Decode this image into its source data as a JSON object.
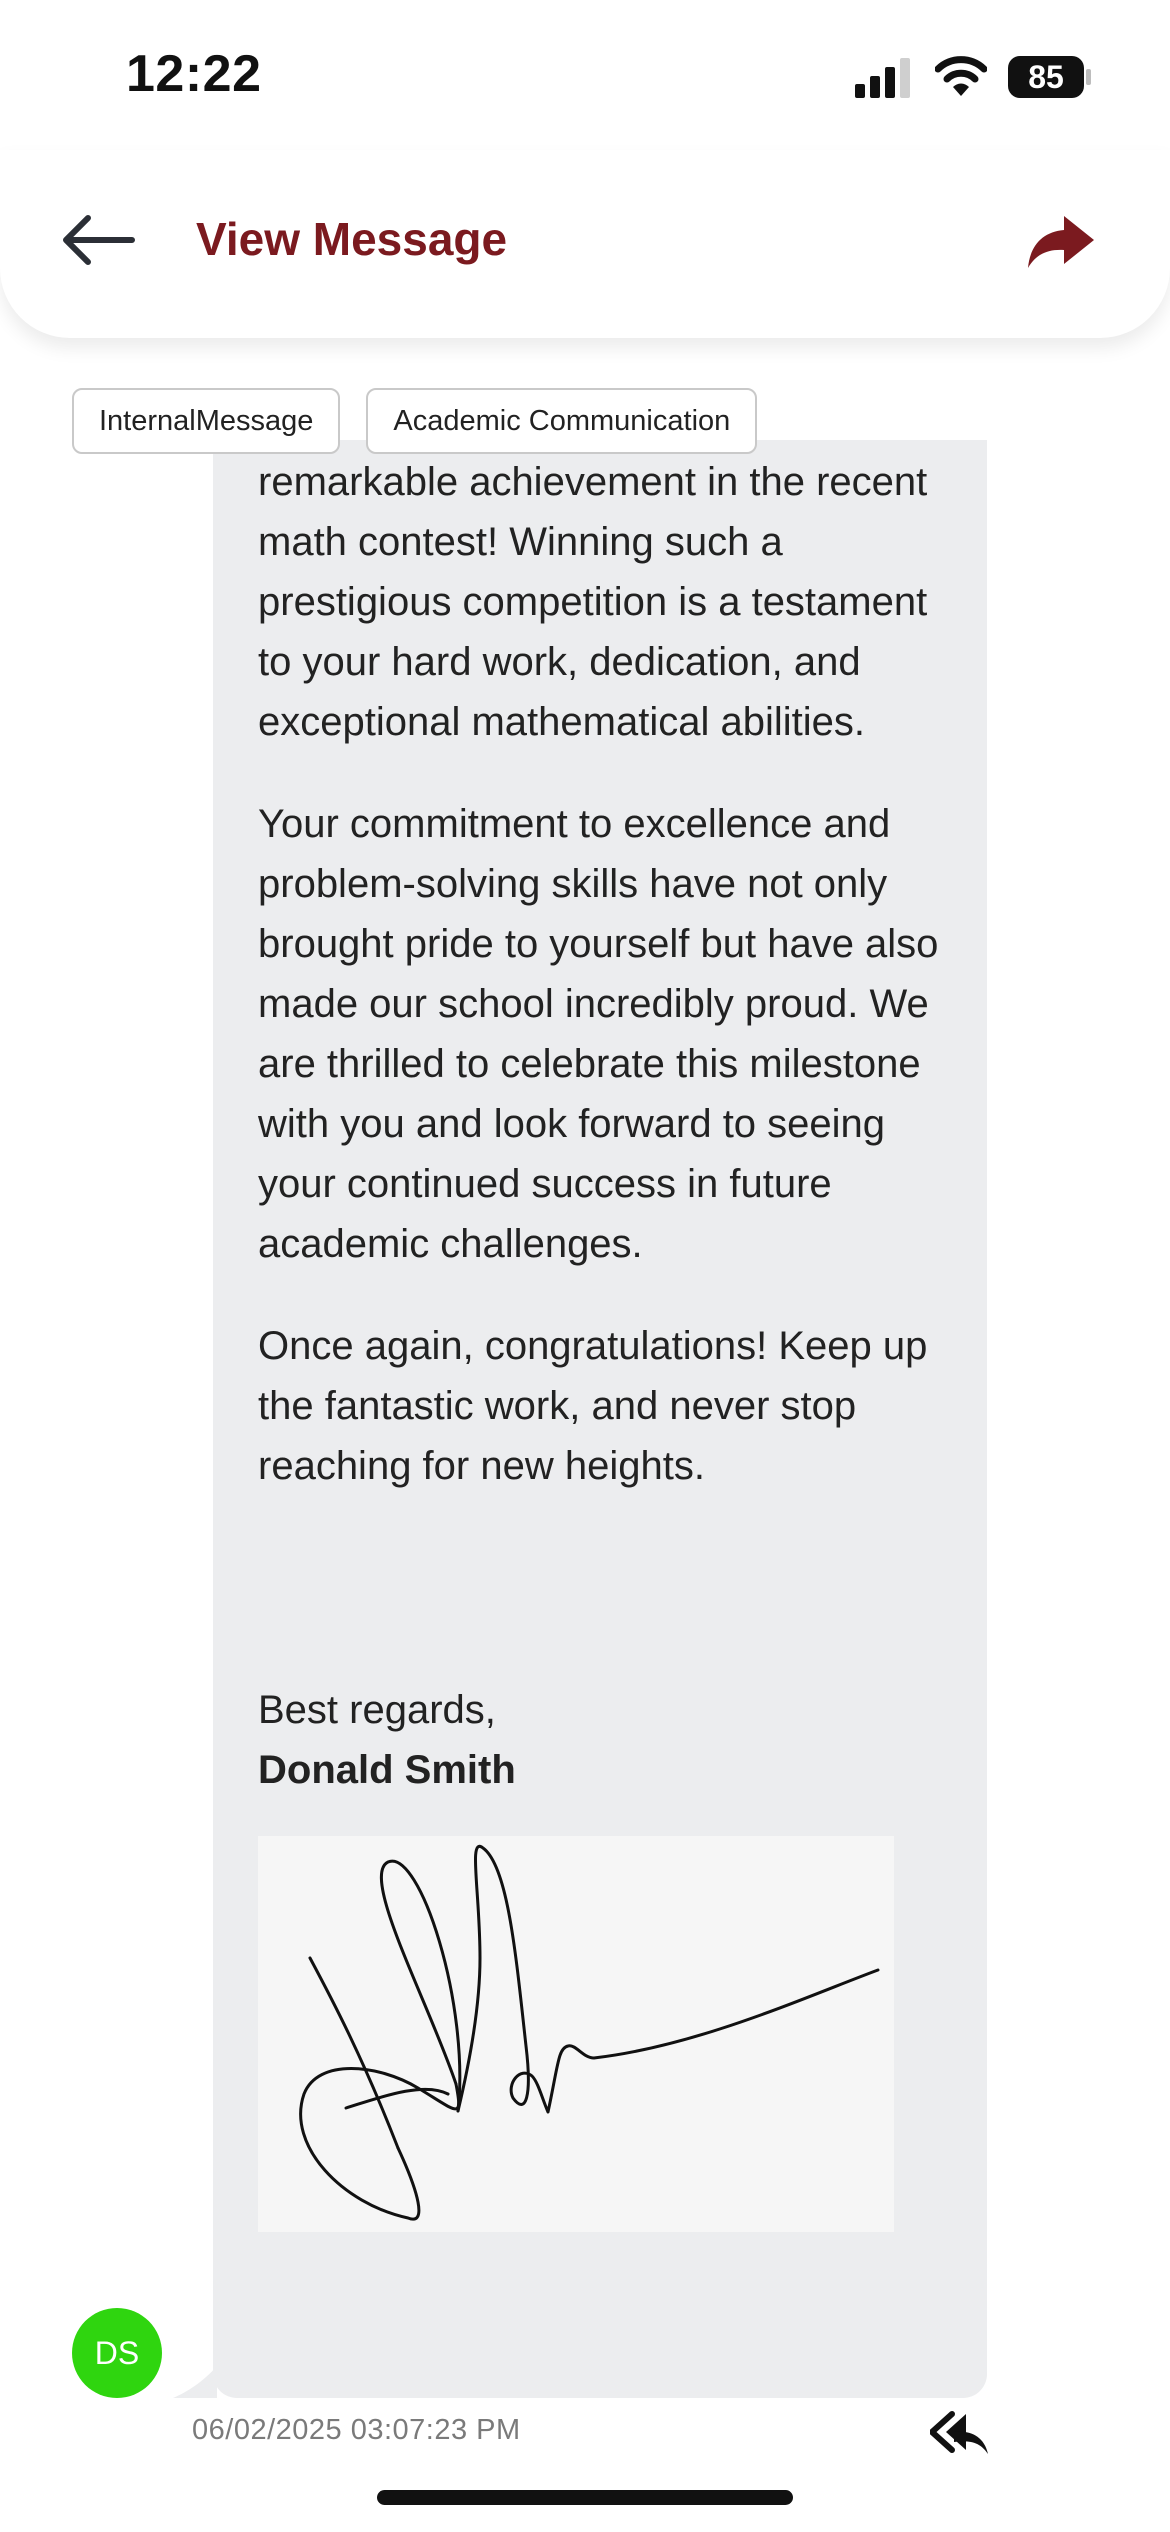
{
  "status_bar": {
    "time": "12:22",
    "battery": "85",
    "icons": [
      "cellular-signal-icon",
      "wifi-icon",
      "battery-icon"
    ]
  },
  "header": {
    "title": "View Message",
    "back_icon": "arrow-left-icon",
    "forward_icon": "forward-arrow-icon"
  },
  "tags": [
    "InternalMessage",
    "Academic Communication"
  ],
  "message": {
    "paragraphs": [
      "remarkable achievement in the recent math contest! Winning such a prestigious competition is a testament to your hard work, dedication, and exceptional mathematical abilities.",
      "Your commitment to excellence and problem-solving skills have not only brought pride to yourself but have also made our school incredibly proud. We are thrilled to celebrate this milestone with you and look forward to seeing your continued success in future academic challenges.",
      "Once again, congratulations! Keep up the fantastic work, and never stop reaching for new heights."
    ],
    "closing": "Best regards,",
    "sender_name": "Donald Smith",
    "signature_image": "handwritten-signature"
  },
  "sender": {
    "initials": "DS"
  },
  "meta": {
    "timestamp": "06/02/2025 03:07:23 PM",
    "reply_icon": "reply-all-icon"
  },
  "colors": {
    "brand": "#7b1a1f",
    "avatar": "#2fd50f",
    "bubble": "#ecedef",
    "timestamp": "#7a7a7a"
  }
}
